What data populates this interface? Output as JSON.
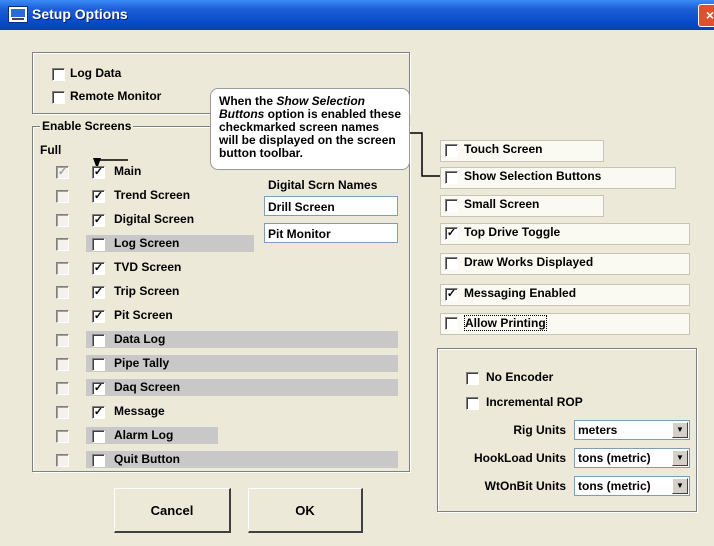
{
  "window": {
    "title": "Setup Options",
    "close_glyph": "×"
  },
  "top_options": [
    {
      "label": "Log Data",
      "checked": false
    },
    {
      "label": "Remote Monitor",
      "checked": false
    }
  ],
  "enable_screens": {
    "title": "Enable Screens",
    "full_header": "Full",
    "screens": [
      {
        "label": "Main",
        "full_checked": true,
        "full_disabled": true,
        "checked": true,
        "grey": false
      },
      {
        "label": "Trend Screen",
        "full_checked": false,
        "checked": true,
        "grey": false
      },
      {
        "label": "Digital Screen",
        "full_checked": false,
        "checked": true,
        "grey": false
      },
      {
        "label": "Log Screen",
        "full_checked": false,
        "checked": false,
        "grey": true
      },
      {
        "label": "TVD Screen",
        "full_checked": false,
        "checked": true,
        "grey": false
      },
      {
        "label": "Trip Screen",
        "full_checked": false,
        "checked": true,
        "grey": false
      },
      {
        "label": "Pit Screen",
        "full_checked": false,
        "checked": true,
        "grey": false
      },
      {
        "label": "Data Log",
        "full_checked": false,
        "checked": false,
        "grey": true
      },
      {
        "label": "Pipe Tally",
        "full_checked": false,
        "checked": false,
        "grey": true
      },
      {
        "label": "Daq Screen",
        "full_checked": false,
        "checked": true,
        "grey": true
      },
      {
        "label": "Message",
        "full_checked": false,
        "checked": true,
        "grey": false
      },
      {
        "label": "Alarm Log",
        "full_checked": false,
        "checked": false,
        "grey": true
      },
      {
        "label": "Quit Button",
        "full_checked": false,
        "checked": false,
        "grey": true
      }
    ]
  },
  "digital_names": {
    "header": "Digital Scrn Names",
    "fields": [
      "Drill Screen",
      "Pit Monitor"
    ]
  },
  "callout": {
    "part1": "When the ",
    "part2": "Show Selection Buttons",
    "part3": " option is enabled these checkmarked screen names will be displayed on the screen button toolbar."
  },
  "right_options": [
    {
      "label": "Touch Screen",
      "checked": false
    },
    {
      "label": "Show Selection Buttons",
      "checked": false
    },
    {
      "label": "Small Screen",
      "checked": false
    },
    {
      "label": "Top Drive Toggle",
      "checked": true
    },
    {
      "label": "Draw Works Displayed",
      "checked": false
    },
    {
      "label": "Messaging Enabled",
      "checked": true
    },
    {
      "label": "Allow Printing",
      "checked": false
    }
  ],
  "encoder": {
    "no_encoder": {
      "label": "No Encoder",
      "checked": false
    },
    "incremental_rop": {
      "label": "Incremental ROP",
      "checked": false
    },
    "selects": [
      {
        "label": "Rig Units",
        "value": "meters"
      },
      {
        "label": "HookLoad Units",
        "value": "tons (metric)"
      },
      {
        "label": "WtOnBit Units",
        "value": "tons (metric)"
      }
    ]
  },
  "buttons": {
    "cancel": "Cancel",
    "ok": "OK"
  },
  "icons": {
    "check": "✓",
    "dropdown": "▼"
  }
}
